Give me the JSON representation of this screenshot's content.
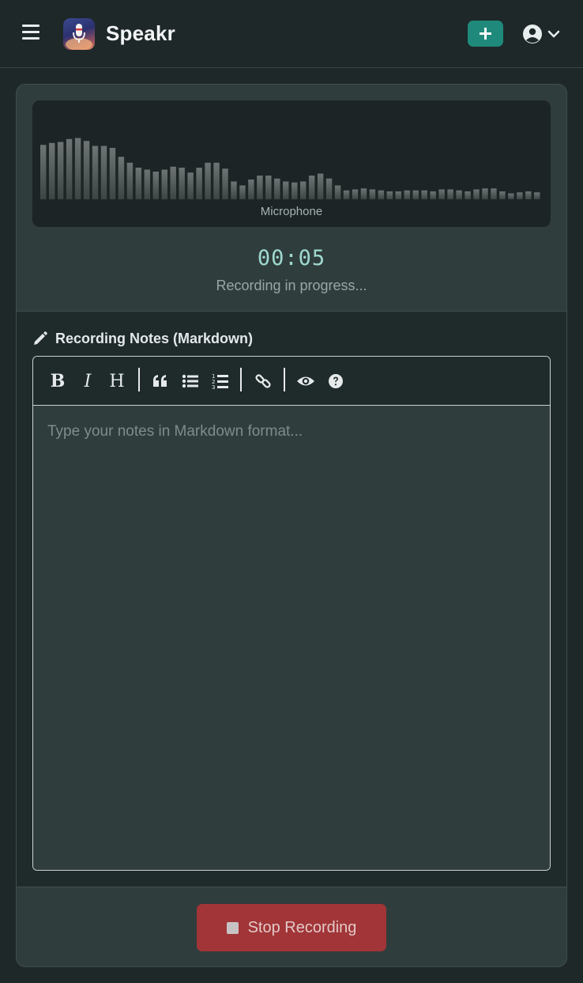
{
  "app": {
    "title": "Speakr"
  },
  "header": {
    "menu_icon": "hamburger-icon",
    "add_icon": "plus-icon",
    "user_icon": "user-circle-icon",
    "caret_icon": "chevron-down-icon",
    "accent": "#1f8a7b"
  },
  "recorder": {
    "source_label": "Microphone",
    "timer": "00:05",
    "status": "Recording in progress...",
    "levels": [
      0.55,
      0.57,
      0.58,
      0.61,
      0.62,
      0.59,
      0.54,
      0.54,
      0.52,
      0.43,
      0.37,
      0.32,
      0.3,
      0.28,
      0.3,
      0.33,
      0.32,
      0.27,
      0.32,
      0.37,
      0.37,
      0.31,
      0.18,
      0.14,
      0.2,
      0.24,
      0.24,
      0.21,
      0.18,
      0.17,
      0.18,
      0.24,
      0.26,
      0.21,
      0.14,
      0.09,
      0.1,
      0.11,
      0.1,
      0.09,
      0.08,
      0.08,
      0.09,
      0.09,
      0.09,
      0.08,
      0.1,
      0.1,
      0.09,
      0.08,
      0.1,
      0.11,
      0.11,
      0.08,
      0.06,
      0.07,
      0.08,
      0.07
    ]
  },
  "notes": {
    "label": "Recording Notes (Markdown)",
    "label_icon": "pencil-icon",
    "placeholder": "Type your notes in Markdown format...",
    "toolbar": {
      "bold": "B",
      "italic": "I",
      "heading": "H",
      "quote_icon": "quote-icon",
      "bullet_list_icon": "bullet-list-icon",
      "numbered_list_icon": "numbered-list-icon",
      "link_icon": "link-icon",
      "preview_icon": "eye-icon",
      "help_icon": "help-circle-icon"
    }
  },
  "footer": {
    "stop_label": "Stop Recording",
    "stop_icon": "stop-square-icon",
    "stop_color": "#a13537"
  }
}
